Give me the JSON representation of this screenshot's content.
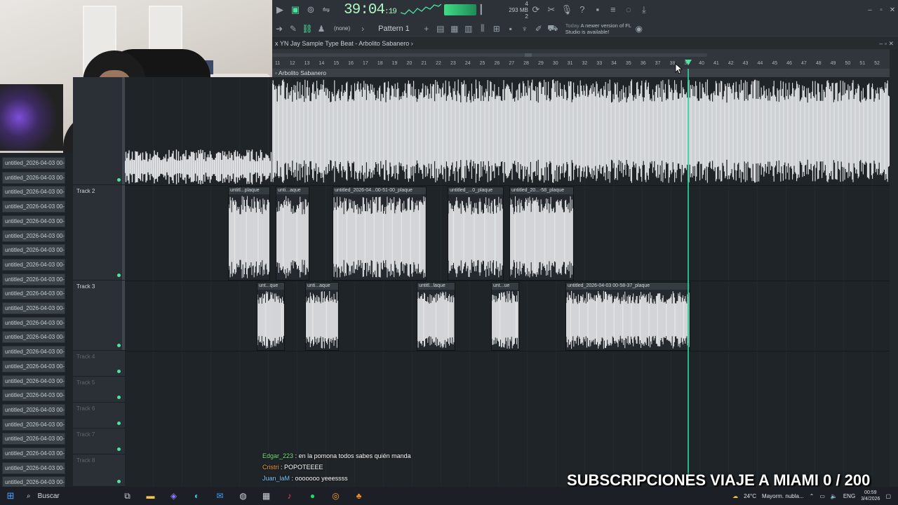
{
  "toolbar": {
    "time_main": "39:04",
    "time_sub": "19",
    "cpu_top": "4",
    "cpu_mem": "293 MB",
    "cpu_bottom": "2"
  },
  "toolbar2": {
    "none_label": "(none)",
    "pattern_label": "Pattern 1",
    "notice_hint": "Today",
    "notice_text": "A newer version of FL Studio is available!"
  },
  "playlist": {
    "title": "x YN Jay Sample Type Beat - Arbolito Sabanero",
    "title_suffix": "›",
    "clip_name": "Arbolito Sabanero",
    "ruler_numbers": [
      "11",
      "12",
      "13",
      "14",
      "15",
      "16",
      "17",
      "18",
      "19",
      "20",
      "21",
      "22",
      "23",
      "24",
      "25",
      "26",
      "27",
      "28",
      "29",
      "30",
      "31",
      "32",
      "33",
      "34",
      "35",
      "36",
      "37",
      "38",
      "39",
      "40",
      "41",
      "42",
      "43",
      "44",
      "45",
      "46",
      "47",
      "48",
      "49",
      "50",
      "51",
      "52"
    ]
  },
  "tracks": [
    {
      "name": "Track 2"
    },
    {
      "name": "Track 3"
    },
    {
      "name": "Track 4"
    },
    {
      "name": "Track 5"
    },
    {
      "name": "Track 6"
    },
    {
      "name": "Track 7"
    },
    {
      "name": "Track 8"
    }
  ],
  "clips_track2": [
    "untitl...plaque",
    "unti...aque",
    "untitled_2026-04...00-51-00_plaque",
    "untitled_...0_plaque",
    "untitled_20...-58_plaque"
  ],
  "clips_track3": [
    "unt...que",
    "unti...aque",
    "untitl...laque",
    "unt...ue",
    "untitled_2026-04-03 00-58-37_plaque"
  ],
  "browser_item": "untitled_2026-04-03 00-...",
  "chat": [
    {
      "user": "Edgar_223",
      "msg": ": en la pomona todos sabes quién manda"
    },
    {
      "user": "Cristri",
      "msg": ": POPOTEEEE"
    },
    {
      "user": "Juan_laM",
      "msg": ": ooooooo yeeessss"
    }
  ],
  "overlay": {
    "subs_text": "SUBSCRIPCIONES VIAJE A MIAMI 0 / 200"
  },
  "taskbar": {
    "search_label": "Buscar",
    "weather": "24°C",
    "weather_desc": "Mayorm. nubla...",
    "lang": "ENG",
    "time": "00:59",
    "date": "3/4/2026"
  },
  "colors": {
    "accent": "#4ee3a0",
    "playhead": "#2bd49a",
    "waveform": "#e8eaec"
  }
}
